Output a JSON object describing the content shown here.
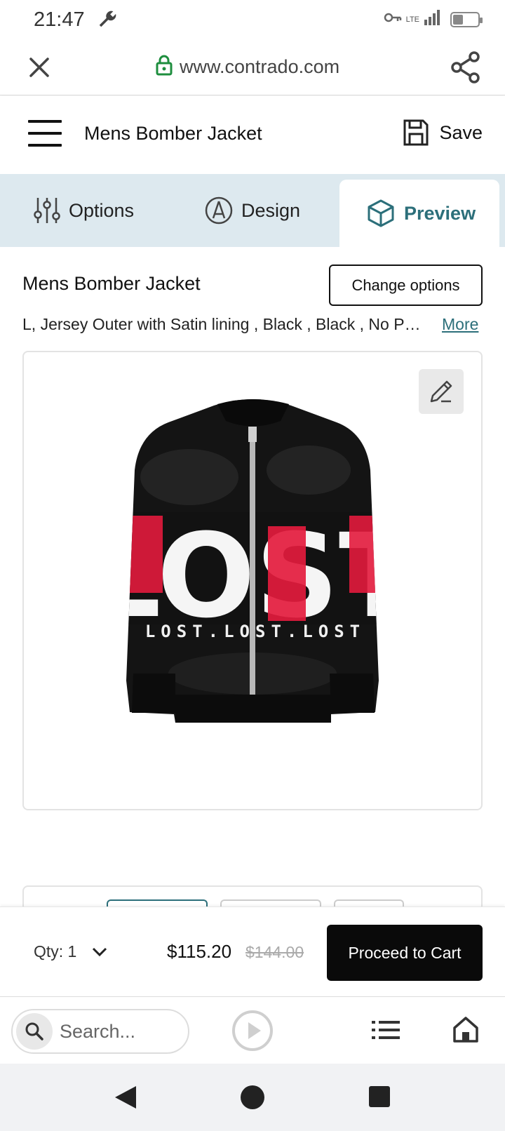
{
  "status_bar": {
    "time": "21:47",
    "network": "LTE",
    "sim_slot": "1",
    "battery_level": 0.4,
    "icons": [
      "wrench-icon",
      "key-icon",
      "signal-icon",
      "battery-icon"
    ]
  },
  "browser": {
    "url": "www.contrado.com",
    "search_placeholder": "Search..."
  },
  "header": {
    "title": "Mens Bomber Jacket",
    "save_label": "Save"
  },
  "tabs": [
    {
      "label": "Options",
      "icon": "sliders-icon",
      "active": false
    },
    {
      "label": "Design",
      "icon": "pen-nib-icon",
      "active": false
    },
    {
      "label": "Preview",
      "icon": "cube-icon",
      "active": true
    }
  ],
  "product": {
    "title": "Mens Bomber Jacket",
    "change_options_label": "Change options",
    "description": "L, Jersey Outer with Satin lining , Black , Black , No Personalisation",
    "more_label": "More",
    "design_text": "LOST",
    "design_subtext": "LOST.LOST.LOST"
  },
  "cart": {
    "qty_label": "Qty: 1",
    "price": "$115.20",
    "original_price": "$144.00",
    "cta_label": "Proceed to Cart"
  },
  "colors": {
    "accent": "#2c6f7a",
    "tab_bar_bg": "#dde9ef",
    "cta_bg": "#0a0a0a",
    "secure_lock": "#1e8e3e",
    "design_red": "#e31b3d"
  }
}
